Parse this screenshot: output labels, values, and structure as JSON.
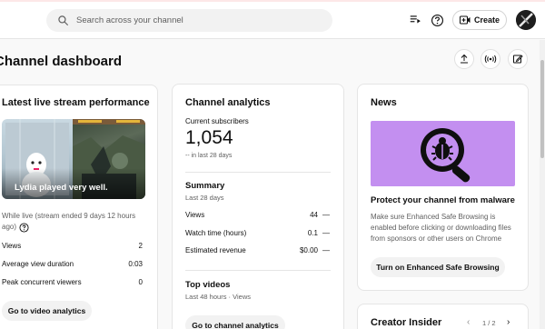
{
  "topbar": {
    "search_placeholder": "Search across your channel",
    "create_label": "Create"
  },
  "page": {
    "title": "Channel dashboard"
  },
  "live": {
    "title": "Latest live stream performance",
    "thumbnail_caption": "Lydia played very well.",
    "status_line1": "While live (stream ended 9 days 12 hours",
    "status_line2": "ago)",
    "stats": [
      {
        "label": "Views",
        "value": "2"
      },
      {
        "label": "Average view duration",
        "value": "0:03"
      },
      {
        "label": "Peak concurrent viewers",
        "value": "0"
      }
    ],
    "button": "Go to video analytics"
  },
  "analytics": {
    "title": "Channel analytics",
    "subscribers_label": "Current subscribers",
    "subscribers_value": "1,054",
    "subscribers_change": "-- in last 28 days",
    "summary_title": "Summary",
    "summary_period": "Last 28 days",
    "rows": [
      {
        "label": "Views",
        "value": "44",
        "trend": "—"
      },
      {
        "label": "Watch time (hours)",
        "value": "0.1",
        "trend": "—"
      },
      {
        "label": "Estimated revenue",
        "value": "$0.00",
        "trend": "—"
      }
    ],
    "top_videos_title": "Top videos",
    "top_videos_period": "Last 48 hours · Views",
    "button": "Go to channel analytics"
  },
  "news": {
    "title": "News",
    "headline": "Protect your channel from malware",
    "body_line1": "Make sure Enhanced Safe Browsing is",
    "body_line2": "enabled before clicking or downloading files",
    "body_line3": "from sponsors or other users on Chrome",
    "button": "Turn on Enhanced Safe Browsing"
  },
  "insider": {
    "title": "Creator Insider",
    "pager": "1 / 2"
  },
  "colors": {
    "news_image_bg": "#c38ff0",
    "accent": "#0f0f0f"
  }
}
